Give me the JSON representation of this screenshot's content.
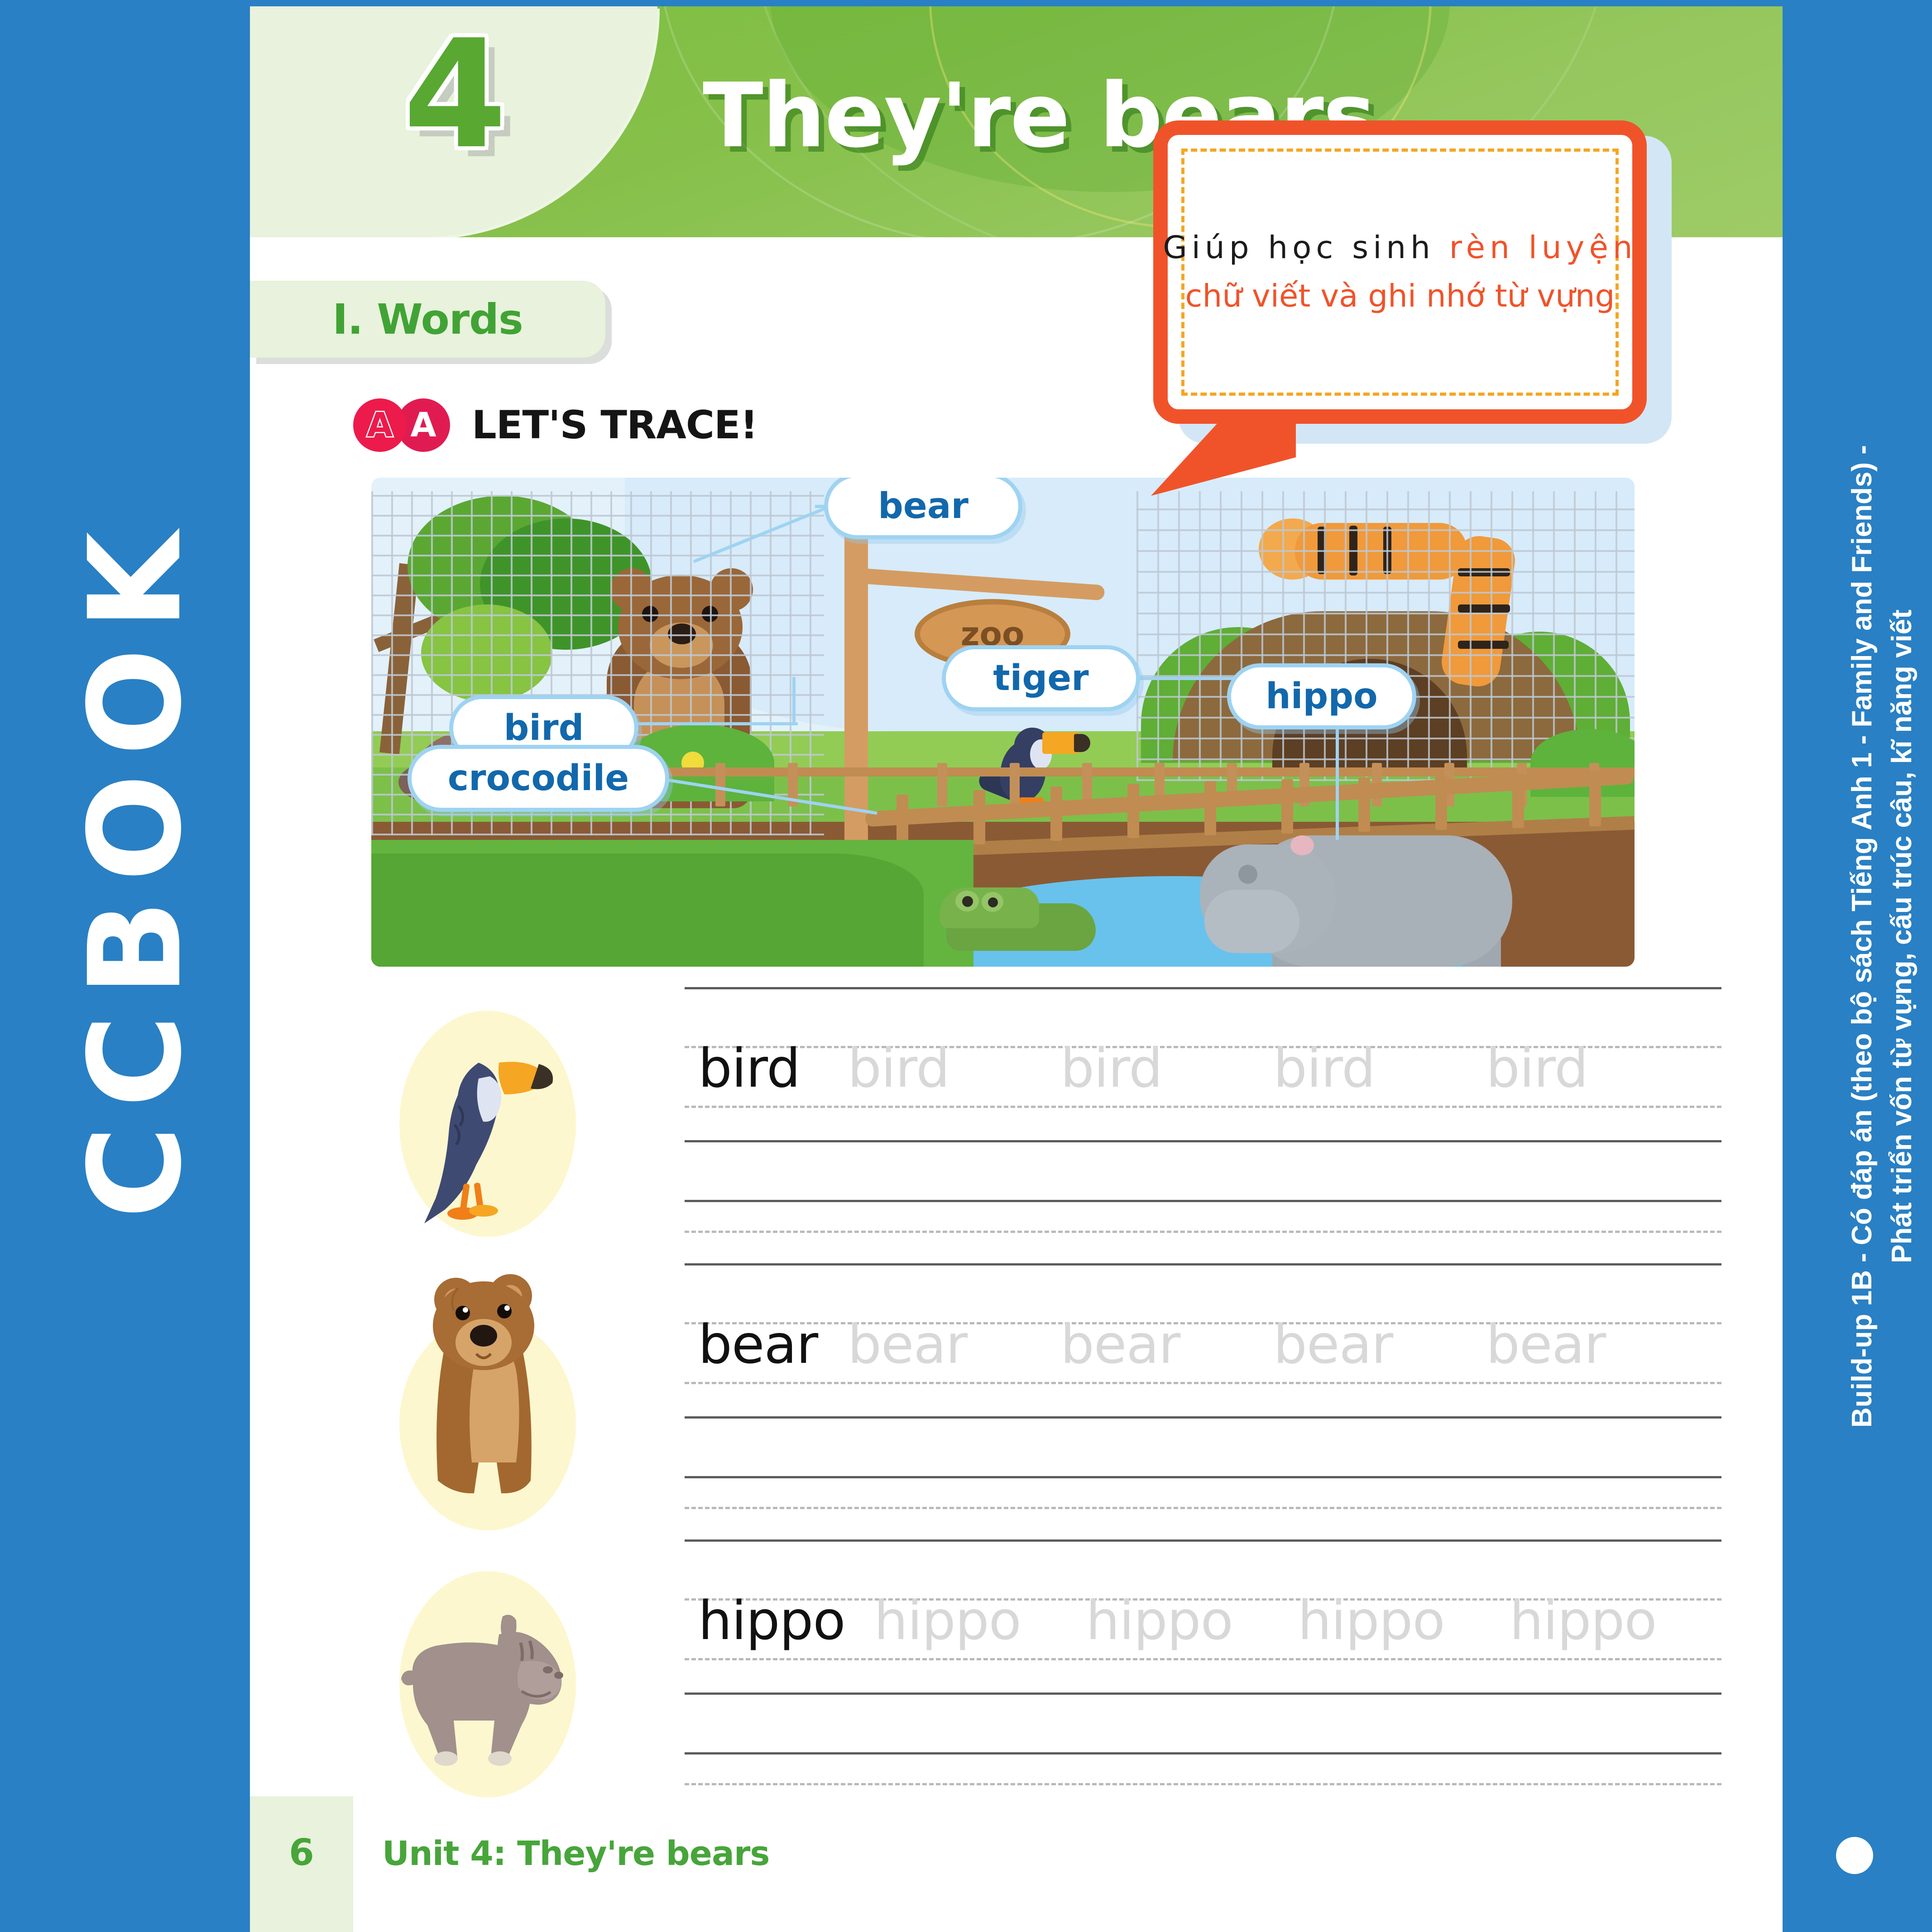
{
  "brand": {
    "name": "CCBOOK"
  },
  "right_rail": {
    "line1": "Build-up 1B - Có đáp án (theo bộ sách Tiếng Anh 1 - Family and Friends) -",
    "line2": "Phát triển vốn từ vựng, cấu trúc câu, kĩ năng viết"
  },
  "header": {
    "unit_number": "4",
    "title": "They're bears"
  },
  "section": {
    "label": "I. Words"
  },
  "activity": {
    "badge_letter_outline": "A",
    "badge_letter_solid": "A",
    "title": "LET'S TRACE!"
  },
  "callout": {
    "line1_black": "Giúp học sinh",
    "line1_orange": "rèn luyện",
    "line2_orange": "chữ viết và ghi nhớ từ vựng",
    "border_color": "#f0532a",
    "dash_color": "#f5a623",
    "accent_text_color": "#f0532a"
  },
  "zoo_scene": {
    "sign_text": "zoo",
    "labels": [
      {
        "id": "bear",
        "text": "bear"
      },
      {
        "id": "tiger",
        "text": "tiger"
      },
      {
        "id": "hippo",
        "text": "hippo"
      },
      {
        "id": "bird",
        "text": "bird"
      },
      {
        "id": "crocodile",
        "text": "crocodile"
      }
    ],
    "label_text_color": "#1268ac",
    "label_border_color": "#9ed3f2"
  },
  "practice_rows": [
    {
      "animal": "bird",
      "word": "bird",
      "ghosts": [
        "bird",
        "bird",
        "bird",
        "bird"
      ]
    },
    {
      "animal": "bear",
      "word": "bear",
      "ghosts": [
        "bear",
        "bear",
        "bear",
        "bear"
      ]
    },
    {
      "animal": "hippo",
      "word": "hippo",
      "ghosts": [
        "hippo",
        "hippo",
        "hippo",
        "hippo"
      ]
    }
  ],
  "footer": {
    "page_number": "6",
    "unit_caption": "Unit 4: They're bears"
  },
  "colors": {
    "rail_blue": "#2980c4",
    "header_green": "#7cbe3f",
    "panel_green": "#e8f2dc",
    "green_text": "#47a53a",
    "badge_red": "#ec1b4b"
  }
}
